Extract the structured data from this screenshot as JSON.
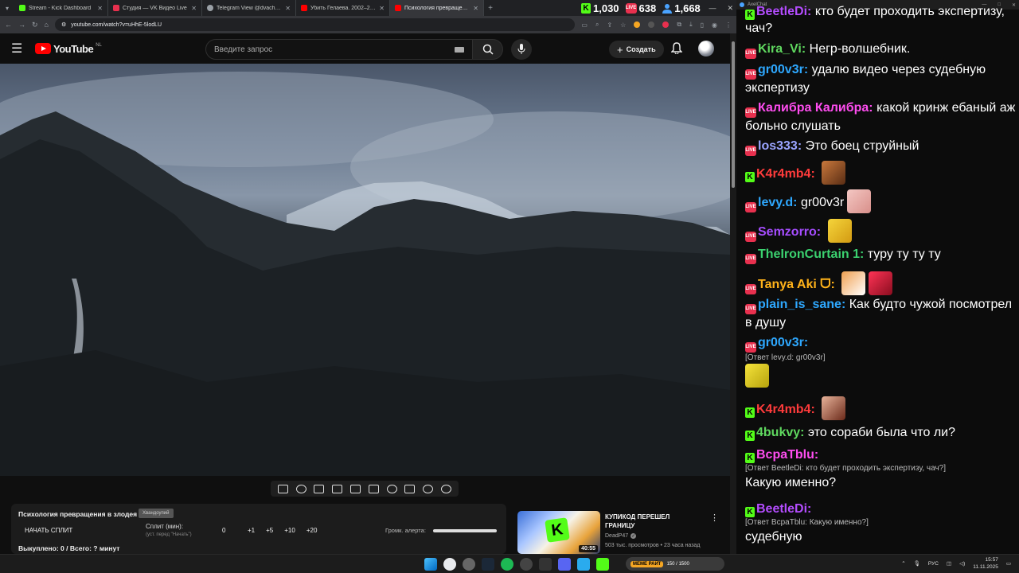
{
  "browser": {
    "tabs": [
      {
        "title": "Stream - Kick Dashboard",
        "color": "#53fc18"
      },
      {
        "title": "Студия — VK Видео Live",
        "color": "#e8304e"
      },
      {
        "title": "Telegram View @dvachannel",
        "color": "#9aa0a6"
      },
      {
        "title": "Убить Гелаева. 2002–2004. - Y",
        "color": "#ff0000"
      },
      {
        "title": "Психология превращения в з",
        "color": "#ff0000"
      }
    ],
    "url": "youtube.com/watch?v=uHhE-5lodLU"
  },
  "stats": {
    "kick_viewers": "1,030",
    "vk_viewers": "638",
    "total_viewers": "1,668"
  },
  "youtube": {
    "logo_text": "YouTube",
    "region": "NL",
    "search_placeholder": "Введите запрос",
    "create_label": "Создать"
  },
  "split_panel": {
    "title": "Психология превращения в злодея",
    "tag": "Хвандоупий",
    "start_label": "НАЧАТЬ СПЛИТ",
    "split_label": "Сплит (мин):",
    "split_hint": "(уст. перед \"Начать\")",
    "split_value": "0",
    "add_buttons": [
      "+1",
      "+5",
      "+10",
      "+20"
    ],
    "volume_label": "Громк. алерта:",
    "sold_text": "Выкуплено: 0 / Всего: ? минут"
  },
  "recommended": {
    "title": "КУПИКОД ПЕРЕШЕЛ ГРАНИЦУ",
    "channel": "DeadP47",
    "views": "503 тыс. просмотров",
    "age": "23 часа назад",
    "duration": "40:55"
  },
  "chat": {
    "window_title": "AxelChat",
    "messages": [
      {
        "platform": "kick",
        "user": "BeetleDi:",
        "user_color": "#b44dff",
        "text": "кто будет проходить экспертизу, чач?"
      },
      {
        "platform": "vk",
        "user": "Kira_Vi:",
        "user_color": "#5fd85f",
        "text": "Негр-волшебник."
      },
      {
        "platform": "vk",
        "user": "gr00v3r:",
        "user_color": "#2ea8ff",
        "text": "удалю видео через судебную экспертизу"
      },
      {
        "platform": "vk",
        "user": "Калибра Калибра:",
        "user_color": "#ff4df0",
        "text": "какой кринж ебаный аж больно слушать"
      },
      {
        "platform": "vk",
        "user": "los333:",
        "user_color": "#9aa4ff",
        "text": "Это боец струйный"
      },
      {
        "platform": "kick",
        "user": "K4r4mb4:",
        "user_color": "#ff3b3b",
        "text": ""
      },
      {
        "platform": "vk",
        "user": "levy.d:",
        "user_color": "#2ea8ff",
        "text": "gr00v3r"
      },
      {
        "platform": "vk",
        "user": "Semzorro:",
        "user_color": "#a64dff",
        "text": ""
      },
      {
        "platform": "vk",
        "user": "TheIronCurtain 1:",
        "user_color": "#3bd16f",
        "text": "туру ту ту ту"
      },
      {
        "platform": "vk",
        "user": "Tanya Aki ᗜ:",
        "user_color": "#ffb21a",
        "text": ""
      },
      {
        "platform": "vk",
        "user": "plain_is_sane:",
        "user_color": "#2ea8ff",
        "text": "Как будто чужой посмотрел в душу"
      },
      {
        "platform": "vk",
        "user": "gr00v3r:",
        "user_color": "#2ea8ff",
        "text": "",
        "reply": "[Ответ levy.d: gr00v3r]"
      },
      {
        "platform": "kick",
        "user": "K4r4mb4:",
        "user_color": "#ff3b3b",
        "text": ""
      },
      {
        "platform": "kick",
        "user": "4bukvy:",
        "user_color": "#5fd85f",
        "text": "это сораби была что ли?"
      },
      {
        "platform": "kick",
        "user": "BcpaTblu:",
        "user_color": "#ff4df0",
        "text": "Какую именно?",
        "reply": "[Ответ BeetleDi: кто будет проходить экспертизу, чач?]"
      },
      {
        "platform": "kick",
        "user": "BeetleDi:",
        "user_color": "#b44dff",
        "text": "судебную",
        "reply": "[Ответ BcpaTblu: Какую именно?]"
      }
    ]
  },
  "taskbar": {
    "widget_label": "МЕМЕ РАЙТ",
    "widget_value": "150 / 1500",
    "lang": "РУС",
    "time": "15:57",
    "date": "11.11.2025"
  }
}
